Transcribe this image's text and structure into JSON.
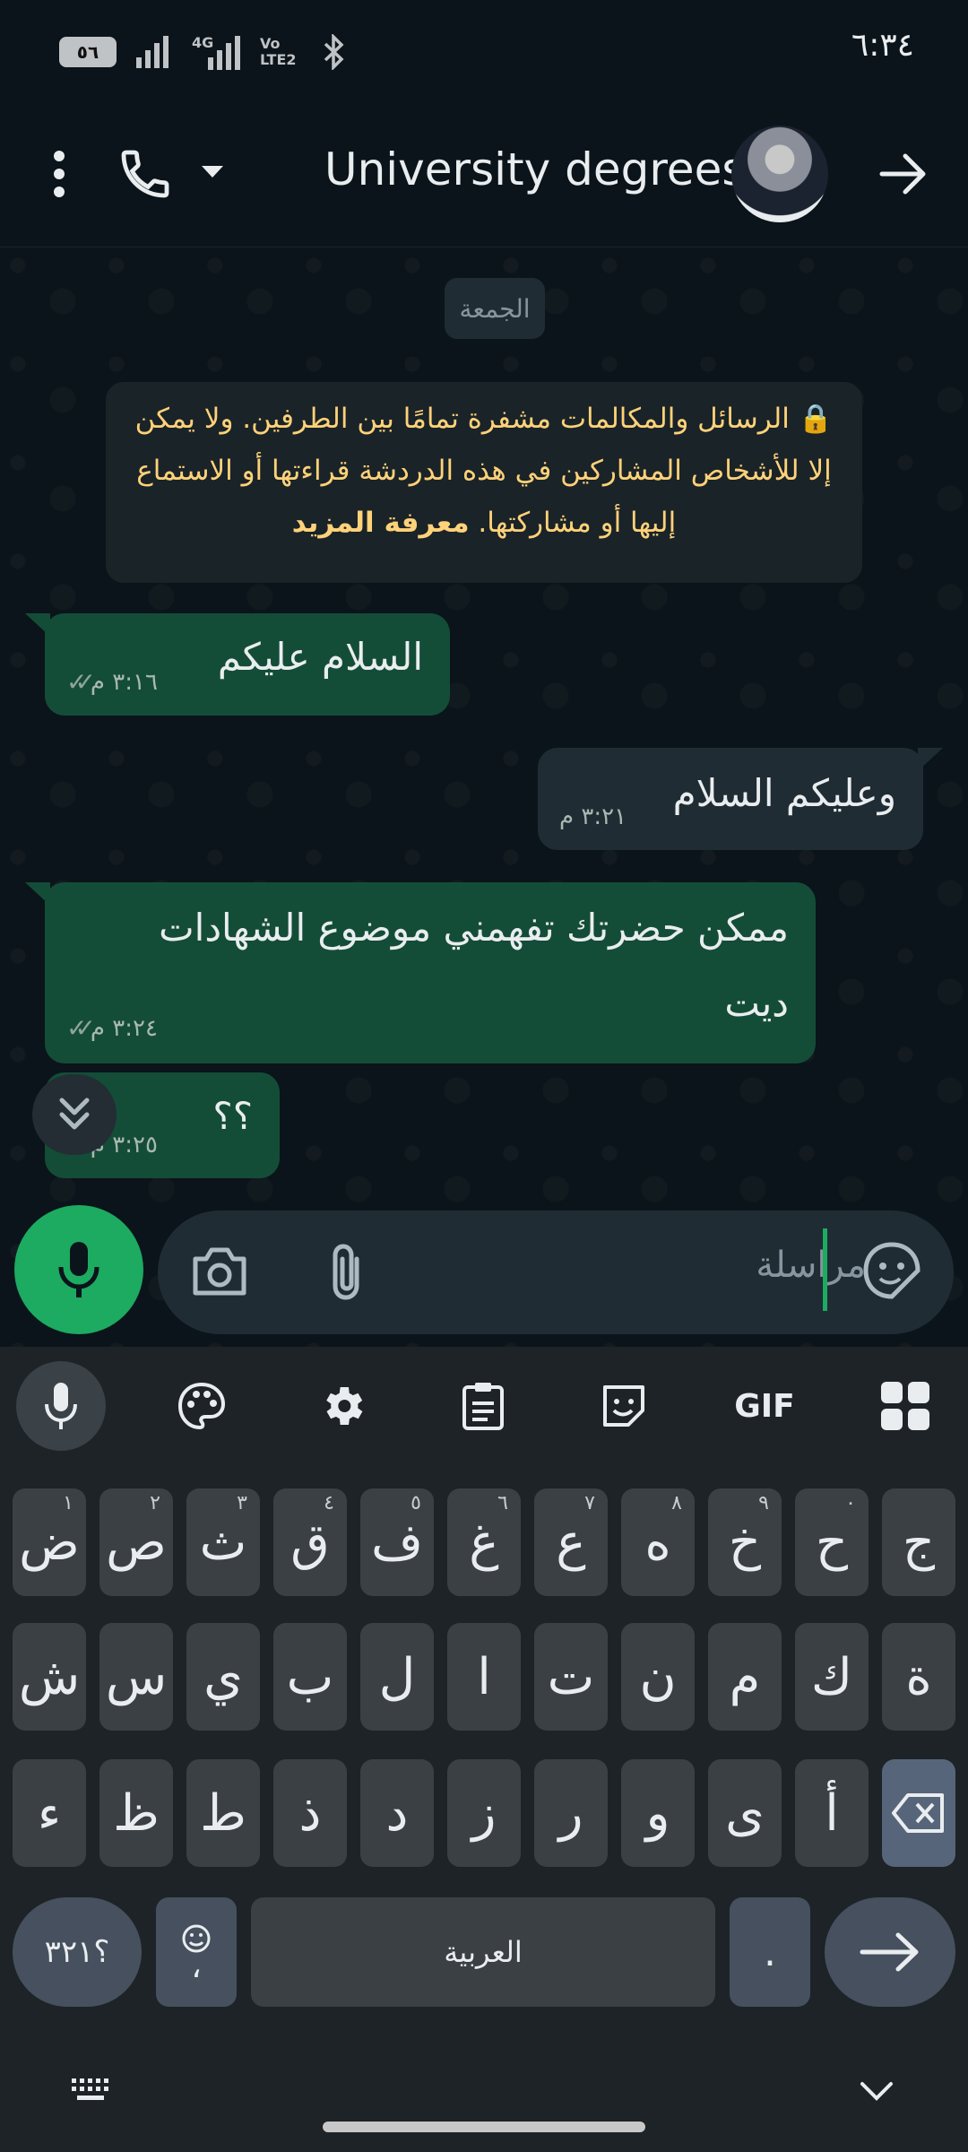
{
  "status_bar": {
    "time": "٦:٣٤",
    "battery": "٥٦",
    "network": "4G",
    "volte": "Vo LTE2"
  },
  "header": {
    "title": "University degrees",
    "icons": [
      "more-icon",
      "phone-icon",
      "dropdown-icon",
      "back-arrow-icon"
    ]
  },
  "chat": {
    "date_label": "الجمعة",
    "encryption_notice": "الرسائل والمكالمات مشفرة تمامًا بين الطرفين. ولا يمكن إلا للأشخاص المشاركين في هذه الدردشة قراءتها أو الاستماع إليها أو مشاركتها.",
    "encryption_link": "معرفة المزيد",
    "messages": [
      {
        "direction": "out",
        "text": "السلام عليكم",
        "time": "٣:١٦ م",
        "status": "read"
      },
      {
        "direction": "in",
        "text": "وعليكم السلام",
        "time": "٣:٢١ م"
      },
      {
        "direction": "out",
        "text_line1": "ممكن حضرتك تفهمني موضوع الشهادات",
        "text_line2": "ديت",
        "time": "٣:٢٤ م",
        "status": "read"
      },
      {
        "direction": "out",
        "text": "؟؟",
        "time": "٣:٢٥ م",
        "status": "read"
      }
    ]
  },
  "composer": {
    "placeholder": "مراسلة",
    "icons": [
      "sticker-icon",
      "attach-icon",
      "camera-icon",
      "mic-icon"
    ]
  },
  "keyboard": {
    "toolbar": [
      "mic-icon",
      "palette-icon",
      "gear-icon",
      "clipboard-icon",
      "sticker-icon",
      "GIF",
      "apps-icon"
    ],
    "gif_label": "GIF",
    "row1": [
      {
        "char": "ج",
        "hint": ""
      },
      {
        "char": "ح",
        "hint": "٠"
      },
      {
        "char": "خ",
        "hint": "٩"
      },
      {
        "char": "ه",
        "hint": "٨"
      },
      {
        "char": "ع",
        "hint": "٧"
      },
      {
        "char": "غ",
        "hint": "٦"
      },
      {
        "char": "ف",
        "hint": "٥"
      },
      {
        "char": "ق",
        "hint": "٤"
      },
      {
        "char": "ث",
        "hint": "٣"
      },
      {
        "char": "ص",
        "hint": "٢"
      },
      {
        "char": "ض",
        "hint": "١"
      }
    ],
    "row2": [
      "ة",
      "ك",
      "م",
      "ن",
      "ت",
      "ا",
      "ل",
      "ب",
      "ي",
      "س",
      "ش"
    ],
    "row3": [
      "أ",
      "ى",
      "و",
      "ر",
      "ز",
      "د",
      "ذ",
      "ط",
      "ظ",
      "ء"
    ],
    "symbols_label": "؟٣٢١",
    "emoji_comma": "،",
    "space_label": "العربية",
    "punct_label": "."
  }
}
